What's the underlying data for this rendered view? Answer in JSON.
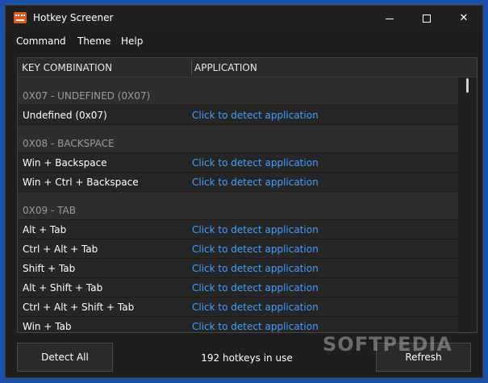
{
  "window": {
    "title": "Hotkey Screener",
    "controls": {
      "minimize": "",
      "maximize": "",
      "close": "✕"
    }
  },
  "menu": [
    "Command",
    "Theme",
    "Help"
  ],
  "table": {
    "columns": [
      "KEY COMBINATION",
      "APPLICATION"
    ],
    "rows": [
      {
        "kind": "group",
        "key": "0X07 - UNDEFINED (0X07)",
        "app": ""
      },
      {
        "kind": "item",
        "key": "Undefined (0x07)",
        "app": "Click to detect application"
      },
      {
        "kind": "group",
        "key": "0X08 - BACKSPACE",
        "app": ""
      },
      {
        "kind": "item",
        "key": "Win + Backspace",
        "app": "Click to detect application"
      },
      {
        "kind": "item",
        "key": "Win + Ctrl + Backspace",
        "app": "Click to detect application"
      },
      {
        "kind": "group",
        "key": "0X09 - TAB",
        "app": ""
      },
      {
        "kind": "item",
        "key": "Alt + Tab",
        "app": "Click to detect application"
      },
      {
        "kind": "item",
        "key": "Ctrl + Alt + Tab",
        "app": "Click to detect application"
      },
      {
        "kind": "item",
        "key": "Shift + Tab",
        "app": "Click to detect application"
      },
      {
        "kind": "item",
        "key": "Alt + Shift + Tab",
        "app": "Click to detect application"
      },
      {
        "kind": "item",
        "key": "Ctrl + Alt + Shift + Tab",
        "app": "Click to detect application"
      },
      {
        "kind": "item",
        "key": "Win + Tab",
        "app": "Click to detect application"
      }
    ]
  },
  "footer": {
    "detect_all": "Detect All",
    "status": "192 hotkeys in use",
    "refresh": "Refresh"
  },
  "watermark": "SOFTPEDIA",
  "colors": {
    "accent_link": "#3f9eff",
    "window_bg": "#1e1e1e",
    "group_text": "#9a9a9a"
  }
}
